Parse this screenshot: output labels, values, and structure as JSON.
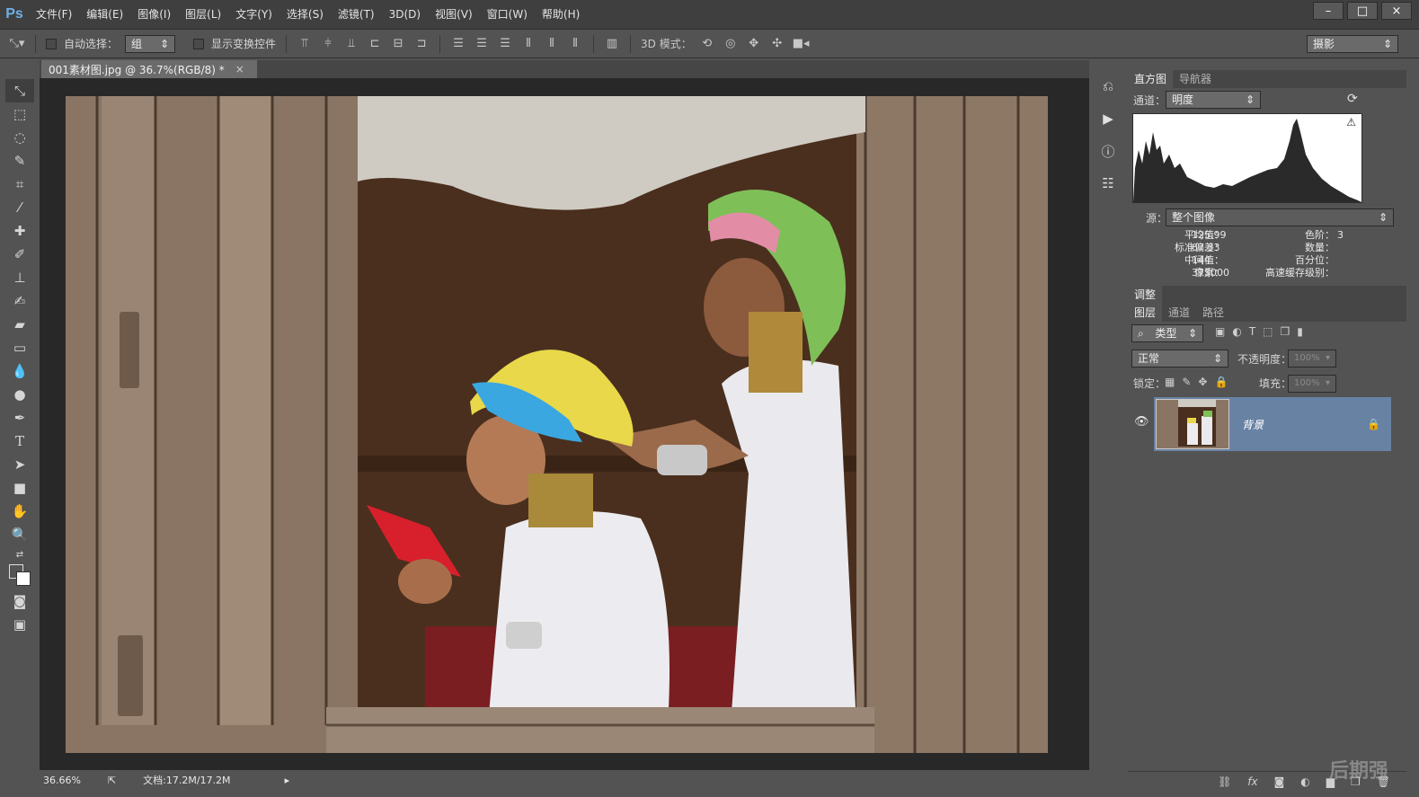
{
  "app": {
    "logo": "Ps"
  },
  "menu": [
    {
      "label": "文件(F)"
    },
    {
      "label": "编辑(E)"
    },
    {
      "label": "图像(I)"
    },
    {
      "label": "图层(L)"
    },
    {
      "label": "文字(Y)"
    },
    {
      "label": "选择(S)"
    },
    {
      "label": "滤镜(T)"
    },
    {
      "label": "3D(D)"
    },
    {
      "label": "视图(V)"
    },
    {
      "label": "窗口(W)"
    },
    {
      "label": "帮助(H)"
    }
  ],
  "window_controls": {
    "minimize": "–",
    "maximize": "□",
    "close": "×"
  },
  "options": {
    "auto_select_label": "自动选择：",
    "auto_select_value": "组",
    "show_transform_label": "显示变换控件",
    "mode_3d_label": "3D 模式：",
    "workspace": "摄影"
  },
  "document": {
    "tab_title": "001素材图.jpg @ 36.7%(RGB/8) *",
    "close": "×",
    "zoom": "36.66%",
    "doc_size": "文档:17.2M/17.2M"
  },
  "histogram": {
    "tabs": [
      "直方图",
      "导航器"
    ],
    "channel_label": "通道：",
    "channel_value": "明度",
    "source_label": "源：",
    "source_value": "整个图像",
    "stats_left": [
      {
        "label": "平均值：",
        "value": "125.99"
      },
      {
        "label": "标准偏差：",
        "value": "67.33"
      },
      {
        "label": "中间值：",
        "value": "144"
      },
      {
        "label": "像素：",
        "value": "375000"
      }
    ],
    "stats_right": [
      {
        "label": "色阶：",
        "value": ""
      },
      {
        "label": "数量：",
        "value": ""
      },
      {
        "label": "百分位：",
        "value": ""
      },
      {
        "label": "高速缓存级别：",
        "value": "3"
      }
    ]
  },
  "adjust_tab": "调整",
  "layers": {
    "tabs": [
      "图层",
      "通道",
      "路径"
    ],
    "filter_value": "类型",
    "blend_mode": "正常",
    "opacity_label": "不透明度：",
    "opacity_value": "100%",
    "lock_label": "锁定：",
    "fill_label": "填充：",
    "fill_value": "100%",
    "layer_name": "背景"
  },
  "footer_icons": [
    "link-icon",
    "fx-icon",
    "mask-icon",
    "adjustment-icon",
    "folder-icon",
    "new-layer-icon",
    "trash-icon"
  ],
  "watermark": "后期强",
  "colors": {
    "accent": "#6fb0e8",
    "selected_layer": "#6882a4",
    "panel_bg": "#535353",
    "menubar": "#3f3f3f"
  }
}
